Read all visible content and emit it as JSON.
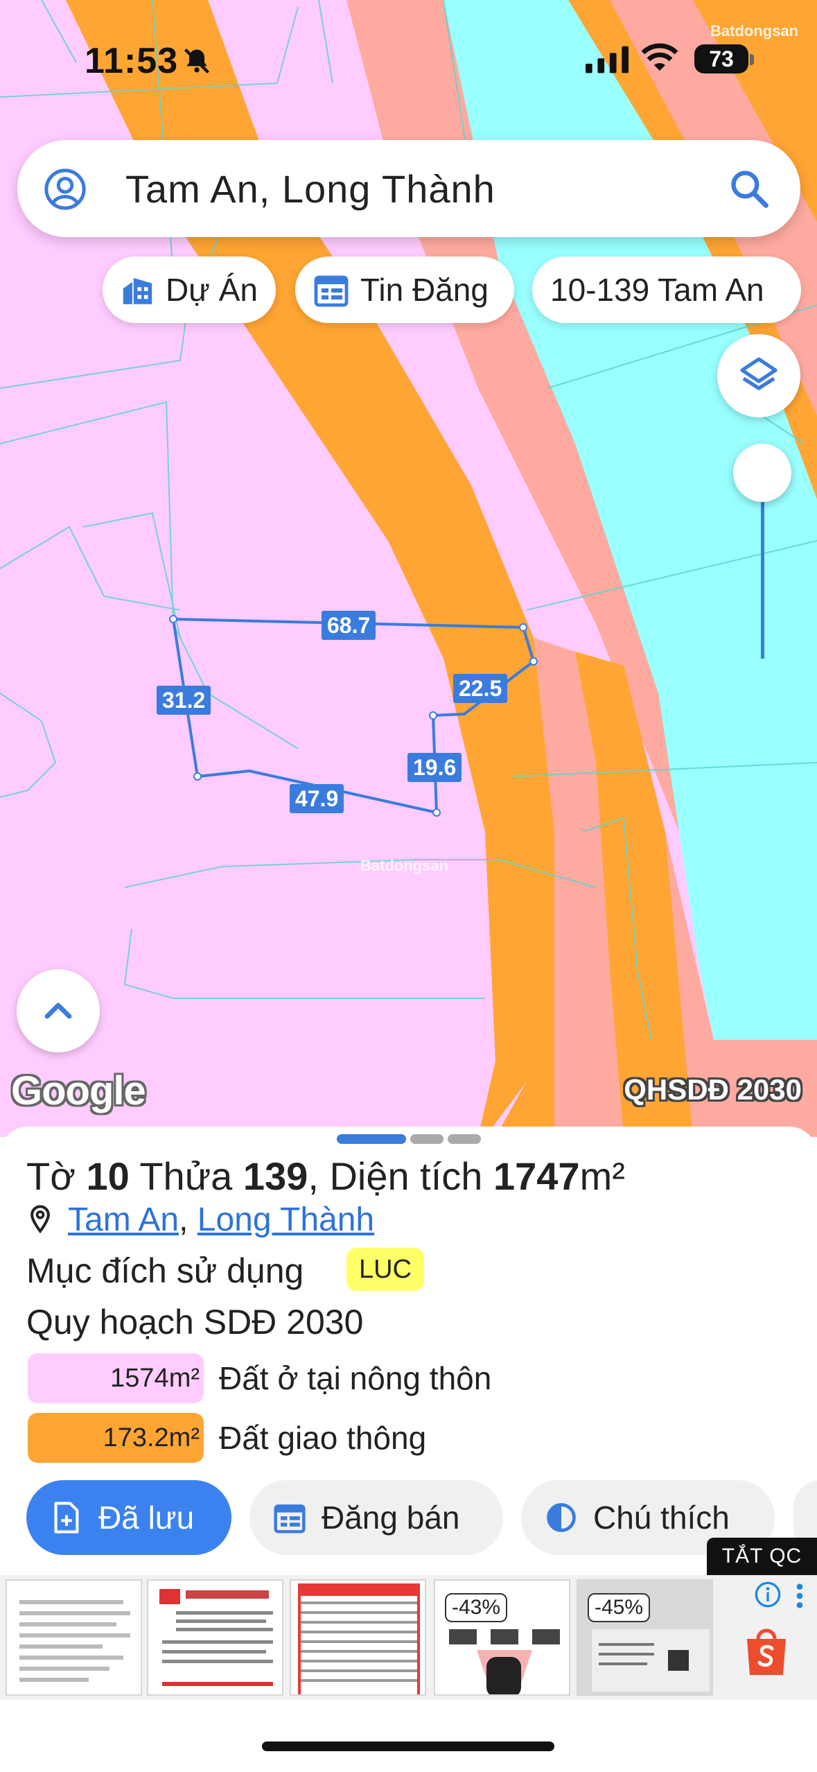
{
  "status_bar": {
    "time": "11:53",
    "battery": "73",
    "watermark": "Batdongsan"
  },
  "search": {
    "text": "Tam An, Long Thành"
  },
  "chips": [
    {
      "label": "Dự Án"
    },
    {
      "label": "Tin Đăng"
    },
    {
      "label": "10-139 Tam An"
    }
  ],
  "map": {
    "parcel_edges": [
      "68.7",
      "22.5",
      "31.2",
      "19.6",
      "47.9"
    ],
    "map_watermark": "Batdongsan",
    "google_logo": "Google",
    "layer_label": "QHSDĐ 2030",
    "colors": {
      "residential": "#ffccff",
      "transport": "#ffa533",
      "commercial": "#ffaaa0",
      "water": "#99ffff",
      "parcel": "#3a7bde"
    }
  },
  "parcel": {
    "prefix_sheet": "Tờ",
    "sheet": "10",
    "prefix_plot": "Thửa",
    "plot": "139",
    "prefix_area": ", Diện tích",
    "area": "1747",
    "unit": "m²",
    "location_commune": "Tam An",
    "location_sep": ",",
    "location_district": "Long Thành",
    "purpose_label": "Mục đích sử dụng",
    "purpose_code": "LUC",
    "plan_title": "Quy hoạch SDĐ 2030",
    "land_uses": [
      {
        "area": "1574m²",
        "name": "Đất ở tại nông thôn",
        "color": "#ffccff"
      },
      {
        "area": "173.2m²",
        "name": "Đất giao thông",
        "color": "#ffa533"
      }
    ]
  },
  "actions": {
    "saved": "Đã lưu",
    "post": "Đăng bán",
    "legend": "Chú thích"
  },
  "ads": {
    "close_label": "TẮT QC",
    "cards": [
      {
        "discount": ""
      },
      {
        "discount": ""
      },
      {
        "discount": ""
      },
      {
        "discount": "-43%"
      },
      {
        "discount": "-45%"
      }
    ],
    "shop_icon": "shopee-bag-icon"
  }
}
